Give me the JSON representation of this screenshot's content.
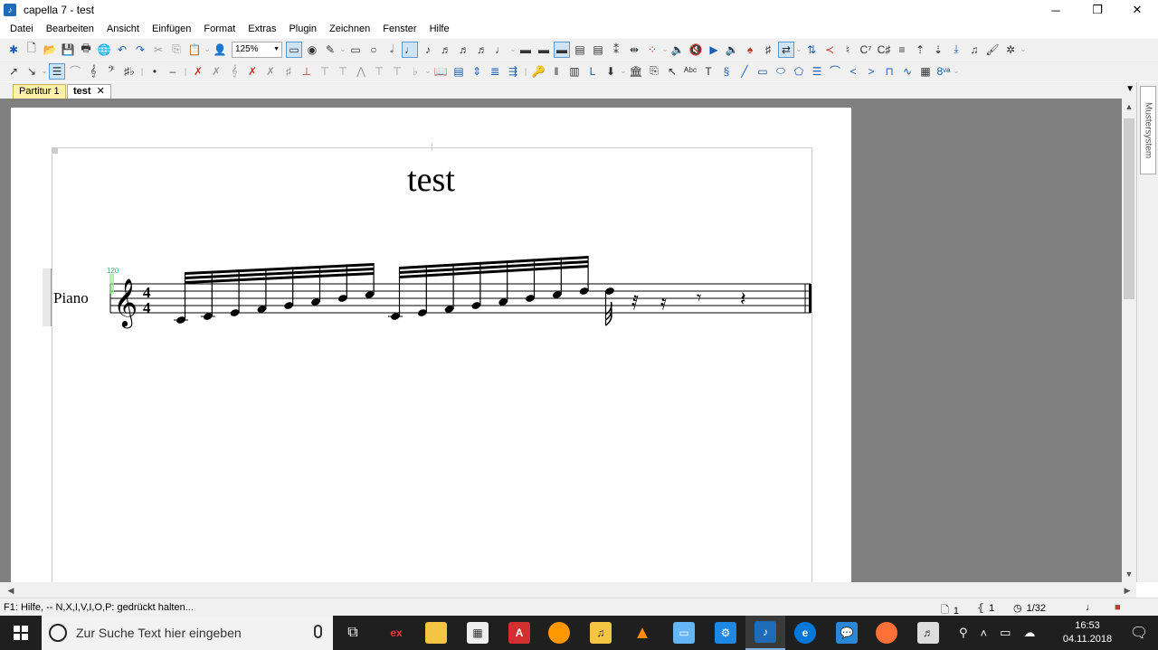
{
  "window": {
    "title": "capella 7 - test",
    "app_icon": "capella-logo-icon",
    "buttons": [
      "minimize-icon",
      "restore-icon",
      "close-icon"
    ]
  },
  "menu": [
    "Datei",
    "Bearbeiten",
    "Ansicht",
    "Einfügen",
    "Format",
    "Extras",
    "Plugin",
    "Zeichnen",
    "Fenster",
    "Hilfe"
  ],
  "toolbar": {
    "zoom": "125%"
  },
  "tabs": {
    "partitur": "Partitur 1",
    "active": "test",
    "close": "✕"
  },
  "score": {
    "title": "test",
    "instrument": "Piano",
    "tempo_marker": "120",
    "time_signature": {
      "top": "4",
      "bottom": "4"
    },
    "clef": "treble",
    "notes": [
      "C4",
      "D4",
      "E4",
      "F4",
      "G4",
      "A4",
      "B4",
      "C5",
      "D4",
      "E4",
      "F4",
      "G4",
      "A4",
      "B4",
      "C5",
      "D5",
      "D5"
    ],
    "rests": [
      "32nd",
      "16th",
      "8th",
      "quarter"
    ]
  },
  "side_panel": {
    "label": "Mustersystem"
  },
  "status": {
    "help": "F1: Hilfe, -- N,X,I,V,I,O,P: gedrückt halten...",
    "page": "1",
    "system": "1",
    "duration": "1/32"
  },
  "taskbar": {
    "search_placeholder": "Zur Suche Text hier eingeben",
    "time": "16:53",
    "date": "04.11.2018"
  },
  "colors": {
    "tab_active_bg": "#fff2a8",
    "taskbar": "#1f1f1f",
    "doc_bg": "#808080",
    "tempo_green": "#3cb371"
  }
}
